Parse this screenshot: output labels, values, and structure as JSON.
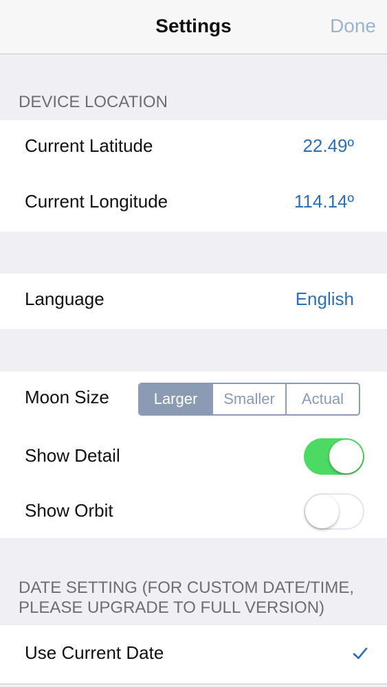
{
  "navbar": {
    "title": "Settings",
    "done_label": "Done"
  },
  "device_location": {
    "header": "DEVICE LOCATION",
    "latitude_label": "Current Latitude",
    "latitude_value": "22.49º",
    "longitude_label": "Current Longitude",
    "longitude_value": "114.14º"
  },
  "language": {
    "label": "Language",
    "value": "English"
  },
  "display": {
    "moon_size_label": "Moon Size",
    "moon_size_options": [
      "Larger",
      "Smaller",
      "Actual"
    ],
    "moon_size_selected": "Larger",
    "show_detail_label": "Show Detail",
    "show_detail_on": true,
    "show_orbit_label": "Show Orbit",
    "show_orbit_on": false
  },
  "date_setting": {
    "header_line1": "DATE SETTING (FOR CUSTOM DATE/TIME,",
    "header_line2": "PLEASE UPGRADE TO FULL VERSION)",
    "use_current_date_label": "Use Current Date",
    "use_current_date_checked": true
  },
  "colors": {
    "accent": "#2c6fb8",
    "toggle_on": "#4cd964",
    "segment": "#8a9bb3",
    "background": "#efeff4"
  }
}
